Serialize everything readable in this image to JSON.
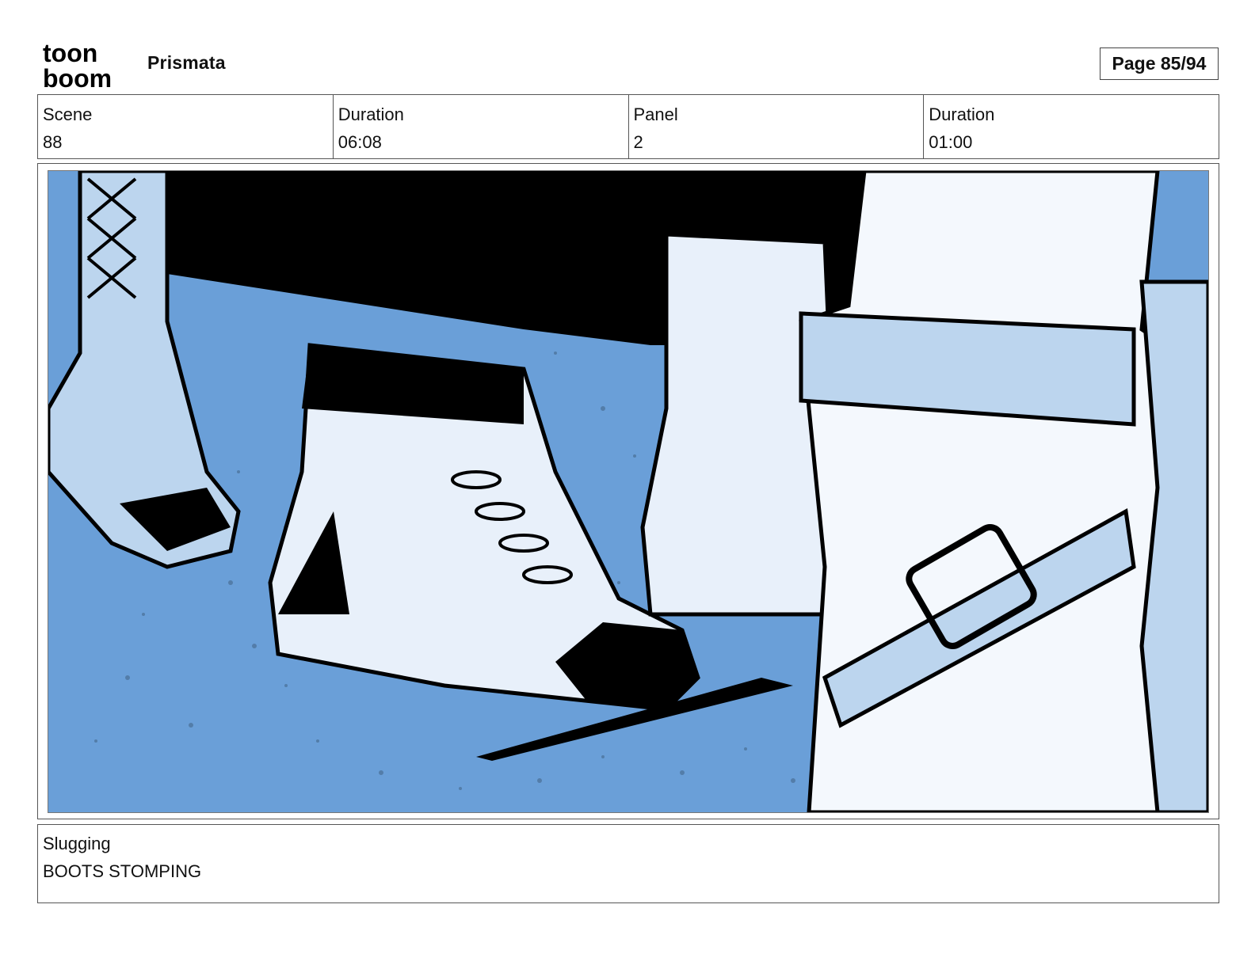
{
  "header": {
    "logo": {
      "line1": "toon",
      "line2": "boom"
    },
    "project_title": "Prismata",
    "page_indicator": "Page 85/94"
  },
  "info": {
    "scene_label": "Scene",
    "scene_value": "88",
    "scene_duration_label": "Duration",
    "scene_duration_value": "06:08",
    "panel_label": "Panel",
    "panel_value": "2",
    "panel_duration_label": "Duration",
    "panel_duration_value": "01:00"
  },
  "panel": {
    "image_subject": "boots-illustration",
    "colors": {
      "floor_blue": "#6a9fd8",
      "light_blue": "#bcd5ee",
      "ink": "#000000",
      "paper": "#ffffff",
      "speckle": "#4a6f96"
    }
  },
  "slugging": {
    "label": "Slugging",
    "text": "BOOTS STOMPING"
  }
}
